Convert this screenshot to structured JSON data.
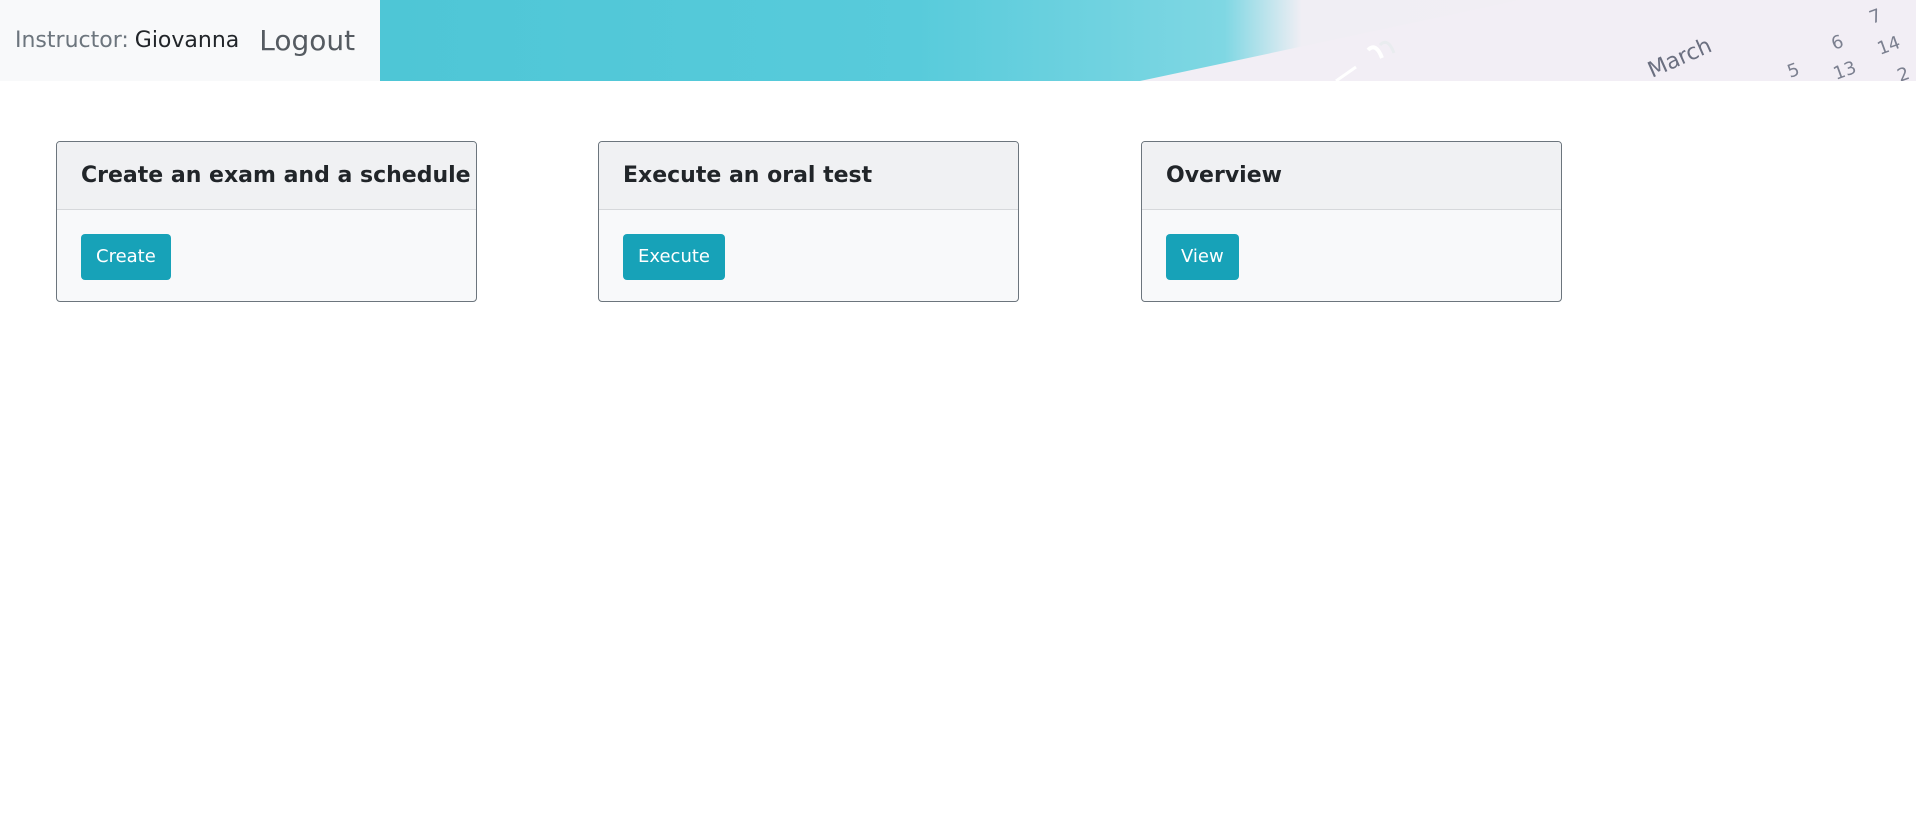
{
  "navbar": {
    "instructor_label": "Instructor:",
    "instructor_name": "Giovanna",
    "logout_label": "Logout"
  },
  "banner": {
    "calendar_month": "March",
    "calendar_numbers": [
      "7",
      "6",
      "14",
      "5",
      "13",
      "2"
    ]
  },
  "cards": [
    {
      "title": "Create an exam and a schedule",
      "button_label": "Create"
    },
    {
      "title": "Execute an oral test",
      "button_label": "Execute"
    },
    {
      "title": "Overview",
      "button_label": "View"
    }
  ],
  "colors": {
    "accent": "#17a2b8",
    "navbar_bg": "#f8f9fa",
    "card_border": "#6c757d"
  }
}
